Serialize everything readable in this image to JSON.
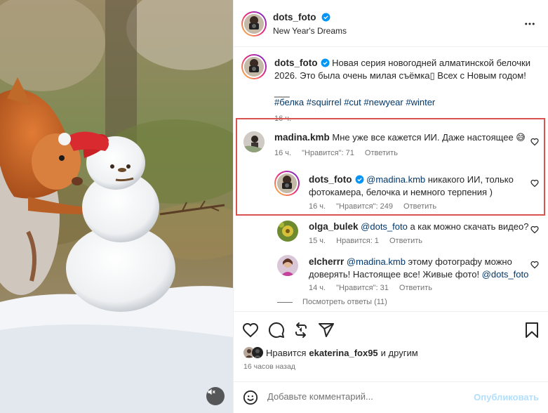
{
  "header": {
    "username": "dots_foto",
    "subtitle": "New Year's Dreams",
    "more_icon": "more-horizontal-icon"
  },
  "caption": {
    "username": "dots_foto",
    "text": "Новая серия новогодней алматинской белочки 2026. Это была очень милая съёмка▯ Всех с Новым годом!",
    "separator": "___",
    "hashtags": "#белка #squirrel #cut #newyear #winter",
    "time": "16 ч."
  },
  "comments": [
    {
      "username": "madina.kmb",
      "text": "Мне уже все кажется ИИ. Даже настоящее 😅",
      "time": "16 ч.",
      "likes": "\"Нравится\": 71",
      "reply": "Ответить"
    },
    {
      "username": "dots_foto",
      "mention": "@madina.kmb",
      "text": " никакого ИИ, только фотокамера, белочка и немного терпения )",
      "time": "16 ч.",
      "likes": "\"Нравится\": 249",
      "reply": "Ответить"
    },
    {
      "username": "olga_bulek",
      "mention": "@dots_foto",
      "text": " а как можно скачать видео?",
      "time": "15 ч.",
      "likes": "Нравится: 1",
      "reply": "Ответить"
    },
    {
      "username": "elcherrr",
      "mention": "@madina.kmb",
      "text": " этому фотографу можно доверять! Настоящее все! Живые фото! ",
      "mention2": "@dots_foto",
      "time": "14 ч.",
      "likes": "\"Нравится\": 31",
      "reply": "Ответить"
    }
  ],
  "view_replies": "Посмотреть ответы (11)",
  "likes_line": {
    "prefix": "Нравится",
    "user": "ekaterina_fox95",
    "suffix": "и другим"
  },
  "time_ago": "16 часов назад",
  "add_comment": {
    "placeholder": "Добавьте комментарий...",
    "publish": "Опубликовать"
  },
  "colors": {
    "highlight_border": "#d9534f",
    "link": "#00376b",
    "verified": "#0095f6",
    "publish_disabled": "#b2dffc"
  }
}
